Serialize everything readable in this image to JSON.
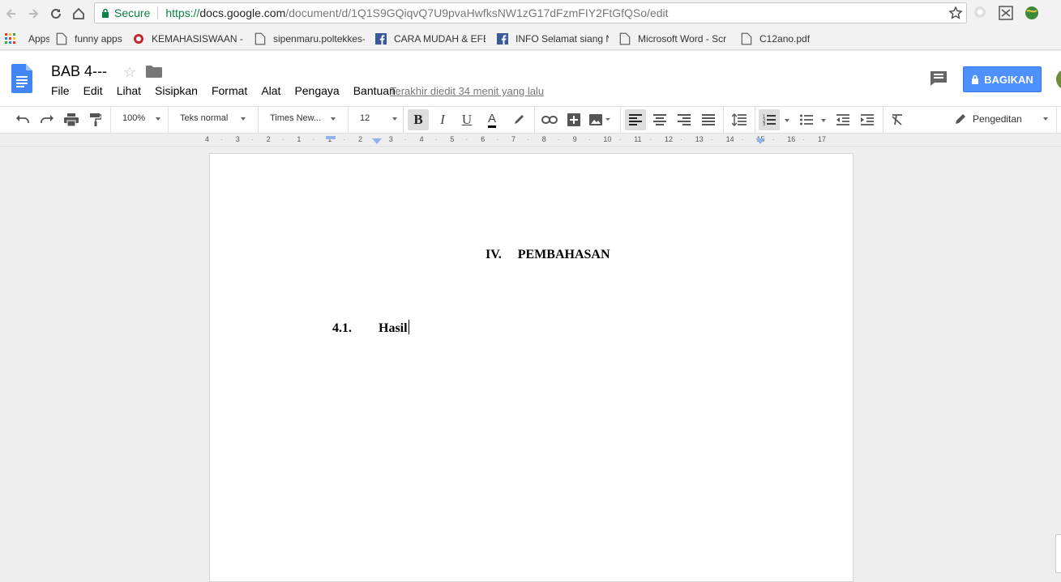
{
  "browser": {
    "secure_label": "Secure",
    "url_proto": "https://",
    "url_host": "docs.google.com",
    "url_path": "/document/d/1Q1S9GQiqvQ7U9pvaHwfksNW1zG17dFzmFIY2FtGfQSo/edit"
  },
  "bookmarks": [
    {
      "label": "Apps",
      "icon": "apps-grid-icon"
    },
    {
      "label": "funny apps",
      "icon": "page-icon"
    },
    {
      "label": "KEMAHASISWAAN - I",
      "icon": "site-logo-icon"
    },
    {
      "label": "sipenmaru.poltekkes-",
      "icon": "page-icon"
    },
    {
      "label": "CARA MUDAH & EFE",
      "icon": "facebook-icon"
    },
    {
      "label": "INFO Selamat siang N",
      "icon": "facebook-icon"
    },
    {
      "label": "Microsoft Word - Scr",
      "icon": "page-icon"
    },
    {
      "label": "C12ano.pdf",
      "icon": "page-icon"
    }
  ],
  "docs": {
    "title": "BAB 4---",
    "menu": [
      "File",
      "Edit",
      "Lihat",
      "Sisipkan",
      "Format",
      "Alat",
      "Pengaya",
      "Bantuan"
    ],
    "last_edit": "Terakhir diedit 34 menit yang lalu",
    "share_label": "BAGIKAN"
  },
  "toolbar": {
    "zoom": "100%",
    "style": "Teks normal",
    "font": "Times New...",
    "size": "12",
    "mode": "Pengeditan",
    "bold_letter": "B",
    "italic_letter": "I",
    "underline_letter": "U",
    "text_color_letter": "A"
  },
  "ruler": {
    "ticks": [
      "4",
      "3",
      "2",
      "1",
      "1",
      "2",
      "3",
      "4",
      "5",
      "6",
      "7",
      "8",
      "9",
      "10",
      "11",
      "12",
      "13",
      "14",
      "15",
      "16",
      "17"
    ]
  },
  "document": {
    "heading_number": "IV.",
    "heading_text": "PEMBAHASAN",
    "subheading_number": "4.1.",
    "subheading_text": "Hasil"
  }
}
